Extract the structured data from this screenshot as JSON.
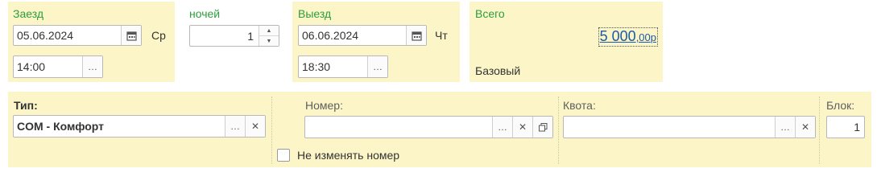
{
  "checkin": {
    "label": "Заезд",
    "date": "05.06.2024",
    "weekday": "Ср",
    "time": "14:00"
  },
  "nights": {
    "label": "ночей",
    "value": "1"
  },
  "checkout": {
    "label": "Выезд",
    "date": "06.06.2024",
    "weekday": "Чт",
    "time": "18:30"
  },
  "total": {
    "label": "Всего",
    "amount": "5 000",
    "cents": ",00",
    "currency": "р",
    "tariff": "Базовый"
  },
  "room_type": {
    "label": "Тип:",
    "value": "COM - Комфорт"
  },
  "room_number": {
    "label": "Номер:",
    "value": "",
    "keep_label": "Не изменять номер",
    "keep_checked": false
  },
  "quota": {
    "label": "Квота:",
    "value": ""
  },
  "block": {
    "label": "Блок:",
    "value": "1"
  },
  "icons": {
    "more": "…",
    "clear": "✕"
  },
  "colors": {
    "panel": "#fbf5c8",
    "label_green": "#2e9d3c",
    "link_blue": "#1c5aa6"
  }
}
